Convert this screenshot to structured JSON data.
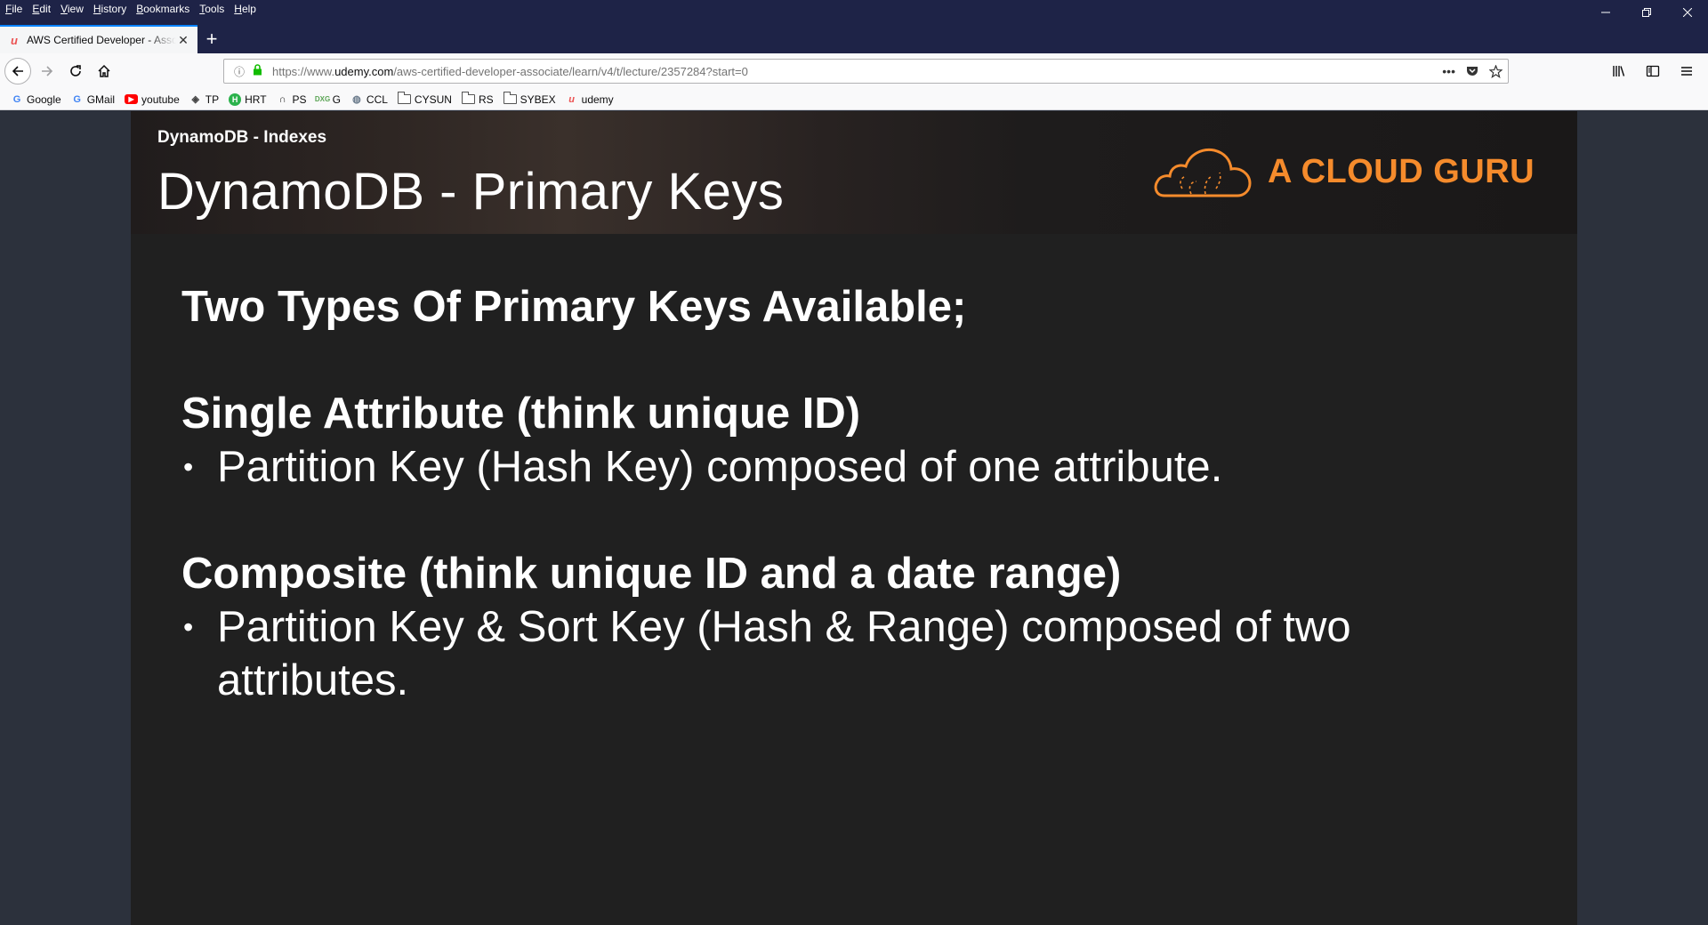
{
  "menu": [
    "File",
    "Edit",
    "View",
    "History",
    "Bookmarks",
    "Tools",
    "Help"
  ],
  "tab": {
    "title": "AWS Certified Developer - Associate",
    "favicon": "udemy-icon"
  },
  "url": {
    "prefix": "https://www.",
    "host": "udemy.com",
    "path": "/aws-certified-developer-associate/learn/v4/t/lecture/2357284?start=0"
  },
  "bookmarks": [
    {
      "label": "Google",
      "icon": "G",
      "color": "#4285f4"
    },
    {
      "label": "GMail",
      "icon": "G",
      "color": "#4285f4"
    },
    {
      "label": "youtube",
      "icon": "▶",
      "color": "#ff0000"
    },
    {
      "label": "TP",
      "icon": "◈",
      "color": "#444444"
    },
    {
      "label": "HRT",
      "icon": "H",
      "color": "#2bb24c"
    },
    {
      "label": "PS",
      "icon": "∩",
      "color": "#222222"
    },
    {
      "label": "G",
      "icon": "G",
      "color": "#5aa454"
    },
    {
      "label": "CCL",
      "icon": "◍",
      "color": "#6b7b8c"
    },
    {
      "label": "CYSUN",
      "icon": "folder"
    },
    {
      "label": "RS",
      "icon": "folder"
    },
    {
      "label": "SYBEX",
      "icon": "folder"
    },
    {
      "label": "udemy",
      "icon": "u",
      "color": "#ec5252"
    }
  ],
  "slide": {
    "subtitle": "DynamoDB - Indexes",
    "title": "DynamoDB - Primary Keys",
    "logo_text": "A CLOUD GURU",
    "heading1": "Two Types Of Primary Keys Available;",
    "heading2": "Single Attribute (think unique ID)",
    "bullet1": "Partition Key (Hash Key) composed of one attribute.",
    "heading3": "Composite (think unique ID and a date range)",
    "bullet2": "Partition Key & Sort Key (Hash & Range) composed of two attributes.",
    "bullet_char": "•"
  },
  "colors": {
    "titlebar": "#1e2347",
    "slide_bg": "#202020",
    "logo": "#f58b2c",
    "page_bg": "#2c313c"
  }
}
